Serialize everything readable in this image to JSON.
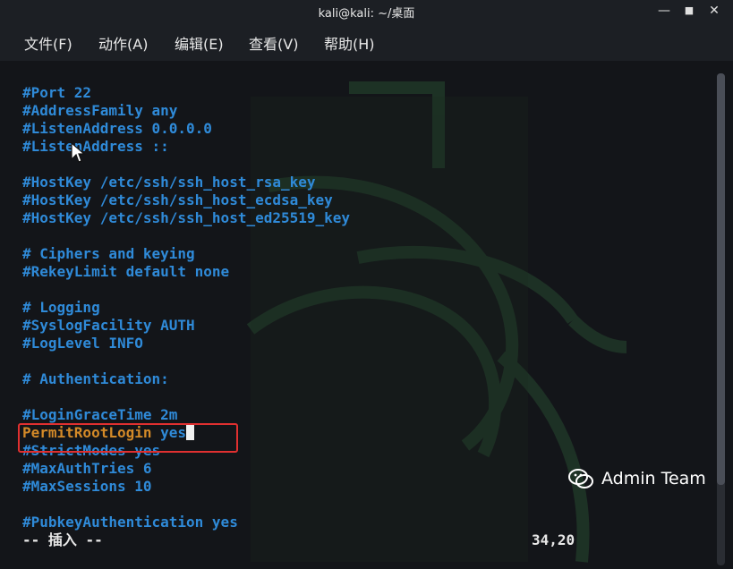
{
  "window": {
    "title": "kali@kali: ~/桌面"
  },
  "window_controls": {
    "minimize": "—",
    "maximize": "■",
    "close": "✕"
  },
  "menu": {
    "items": [
      "文件(F)",
      "动作(A)",
      "编辑(E)",
      "查看(V)",
      "帮助(H)"
    ]
  },
  "editor": {
    "lines": [
      "#Port 22",
      "#AddressFamily any",
      "#ListenAddress 0.0.0.0",
      "#ListenAddress ::",
      "",
      "#HostKey /etc/ssh/ssh_host_rsa_key",
      "#HostKey /etc/ssh/ssh_host_ecdsa_key",
      "#HostKey /etc/ssh/ssh_host_ed25519_key",
      "",
      "# Ciphers and keying",
      "#RekeyLimit default none",
      "",
      "# Logging",
      "#SyslogFacility AUTH",
      "#LogLevel INFO",
      "",
      "# Authentication:",
      "",
      "#LoginGraceTime 2m",
      "",
      "#StrictModes yes",
      "#MaxAuthTries 6",
      "#MaxSessions 10",
      "",
      "#PubkeyAuthentication yes"
    ],
    "active_line": {
      "keyword": "PermitRootLogin",
      "value": "yes"
    },
    "mode": "-- 插入 --",
    "position": "34,20"
  },
  "watermark": {
    "text": "Admin Team"
  },
  "colors": {
    "comment": "#2f8ad8",
    "keyword": "#d48a28",
    "highlight_box": "#e03030"
  }
}
